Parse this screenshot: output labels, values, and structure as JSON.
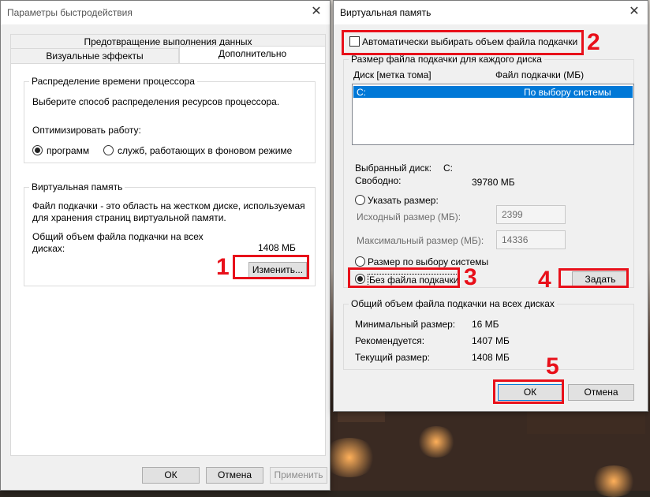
{
  "perf_window": {
    "title": "Параметры быстродействия",
    "tabs": {
      "top": "Предотвращение выполнения данных",
      "visual": "Визуальные эффекты",
      "advanced": "Дополнительно"
    },
    "cpu_group": {
      "label": "Распределение времени процессора",
      "desc": "Выберите способ распределения ресурсов процессора.",
      "optimize_label": "Оптимизировать работу:",
      "radio_programs": "программ",
      "radio_services": "служб, работающих в фоновом режиме"
    },
    "vm_group": {
      "label": "Виртуальная память",
      "desc_line1": "Файл подкачки - это область на жестком диске, используемая",
      "desc_line2": "для хранения страниц виртуальной памяти.",
      "total_line1": "Общий объем файла подкачки на всех",
      "total_line2": "дисках:",
      "total_value": "1408 МБ",
      "change_button": "Изменить..."
    },
    "buttons": {
      "ok": "ОК",
      "cancel": "Отмена",
      "apply": "Применить"
    }
  },
  "vm_window": {
    "title": "Виртуальная память",
    "auto_checkbox": "Автоматически выбирать объем файла подкачки",
    "per_drive_group": {
      "label": "Размер файла подкачки для каждого диска",
      "col_drive": "Диск [метка тома]",
      "col_size": "Файл подкачки (МБ)",
      "rows": [
        {
          "drive": "C:",
          "size": "По выбору системы"
        }
      ],
      "selected_drive_label": "Выбранный диск:",
      "selected_drive_value": "C:",
      "free_label": "Свободно:",
      "free_value": "39780 МБ",
      "radio_custom": "Указать размер:",
      "initial_label": "Исходный размер (МБ):",
      "initial_value": "2399",
      "max_label": "Максимальный размер (МБ):",
      "max_value": "14336",
      "radio_system": "Размер по выбору системы",
      "radio_none": "Без файла подкачки",
      "set_button": "Задать"
    },
    "total_group": {
      "label": "Общий объем файла подкачки на всех дисках",
      "min_label": "Минимальный размер:",
      "min_value": "16 МБ",
      "rec_label": "Рекомендуется:",
      "rec_value": "1407 МБ",
      "cur_label": "Текущий размер:",
      "cur_value": "1408 МБ"
    },
    "buttons": {
      "ok": "ОК",
      "cancel": "Отмена"
    }
  },
  "annotations": {
    "n1": "1",
    "n2": "2",
    "n3": "3",
    "n4": "4",
    "n5": "5"
  },
  "colors": {
    "highlight_red": "#e8101a",
    "selection_blue": "#0078d7"
  }
}
